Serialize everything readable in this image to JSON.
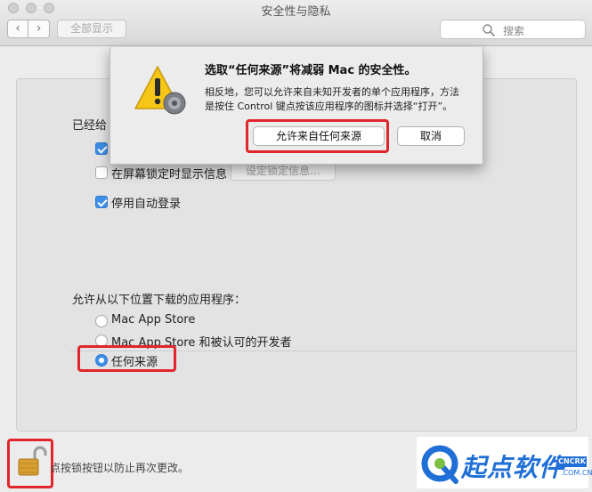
{
  "window": {
    "title": "安全性与隐私",
    "show_all": "全部显示",
    "back_glyph": "‹",
    "forward_glyph": "›",
    "search_placeholder": "搜索"
  },
  "general": {
    "password_heading_partial": "已经给",
    "show_message_label": "在屏幕锁定时显示信息",
    "show_message_checked": false,
    "set_lock_message_button": "设定锁定信息…",
    "disable_autologin_label": "停用自动登录",
    "disable_autologin_checked": true,
    "first_option_checked": true
  },
  "gatekeeper": {
    "heading": "允许从以下位置下载的应用程序：",
    "options": [
      {
        "label": "Mac App Store",
        "selected": false
      },
      {
        "label": "Mac App Store 和被认可的开发者",
        "selected": false
      },
      {
        "label": "任何来源",
        "selected": true
      }
    ]
  },
  "lock": {
    "hint": "点按锁按钮以防止再次更改。"
  },
  "alert": {
    "title": "选取“任何来源”将减弱 Mac 的安全性。",
    "message_line1": "相反地，您可以允许来自未知开发者的单个应用程序，方法",
    "message_line2": "是按住 Control 键点按该应用程序的图标并选择“打开”。",
    "allow_button": "允许来自任何来源",
    "cancel_button": "取消"
  },
  "watermark": {
    "brand": "起点软件",
    "badge": "CNCRK",
    "domain": ".COM.CN"
  },
  "colors": {
    "accent_blue": "#3d8fe8",
    "highlight_red": "#e0262c",
    "watermark_blue": "#1f6fd6"
  },
  "icons": {
    "alert": "warning-triangle-icon",
    "lock": "unlocked-padlock-icon",
    "search": "magnifier-icon"
  }
}
